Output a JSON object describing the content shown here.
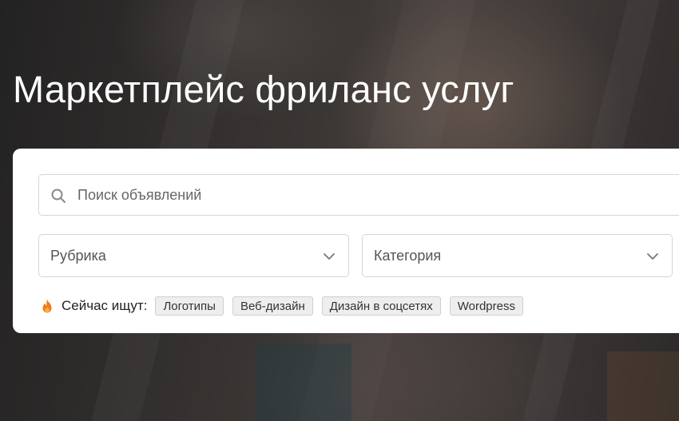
{
  "hero": {
    "title": "Маркетплейс фриланс услуг"
  },
  "search": {
    "placeholder": "Поиск объявлений",
    "icon": "search-icon"
  },
  "filters": {
    "rubric_label": "Рубрика",
    "category_label": "Категория",
    "chevron_icon": "chevron-down-icon"
  },
  "trending": {
    "icon": "flame-icon",
    "icon_color": "#f07a1a",
    "label": "Сейчас ищут:",
    "tags": [
      "Логотипы",
      "Веб-дизайн",
      "Дизайн в соцсетях",
      "Wordpress"
    ]
  }
}
